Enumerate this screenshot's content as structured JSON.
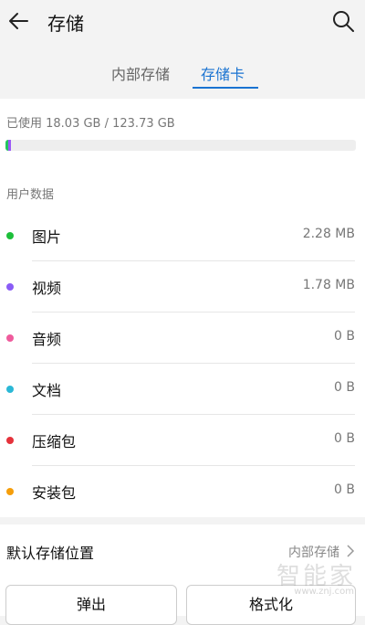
{
  "header": {
    "title": "存储",
    "back_icon": "back-arrow-icon",
    "search_icon": "search-icon"
  },
  "tabs": [
    {
      "label": "内部存储",
      "active": false
    },
    {
      "label": "存储卡",
      "active": true
    }
  ],
  "storage": {
    "used_text": "已使用 18.03 GB / 123.73 GB",
    "used_fraction": 0.0146,
    "segments": [
      {
        "color": "#22c55e",
        "fraction": 0.006
      },
      {
        "color": "#9b59f6",
        "fraction": 0.005
      }
    ]
  },
  "user_data": {
    "title": "用户数据",
    "items": [
      {
        "label": "图片",
        "value": "2.28 MB",
        "color": "#1dbf3a"
      },
      {
        "label": "视频",
        "value": "1.78 MB",
        "color": "#8a5cf6"
      },
      {
        "label": "音频",
        "value": "0 B",
        "color": "#ef5b9c"
      },
      {
        "label": "文档",
        "value": "0 B",
        "color": "#2bb8d6"
      },
      {
        "label": "压缩包",
        "value": "0 B",
        "color": "#e5323b"
      },
      {
        "label": "安装包",
        "value": "0 B",
        "color": "#f59e0b"
      }
    ]
  },
  "default_location": {
    "label": "默认存储位置",
    "value": "内部存储"
  },
  "buttons": {
    "eject": "弹出",
    "format": "格式化"
  },
  "watermark": {
    "text": "智能家",
    "url": "www.znj.com"
  },
  "accent_color": "#1a73d1"
}
